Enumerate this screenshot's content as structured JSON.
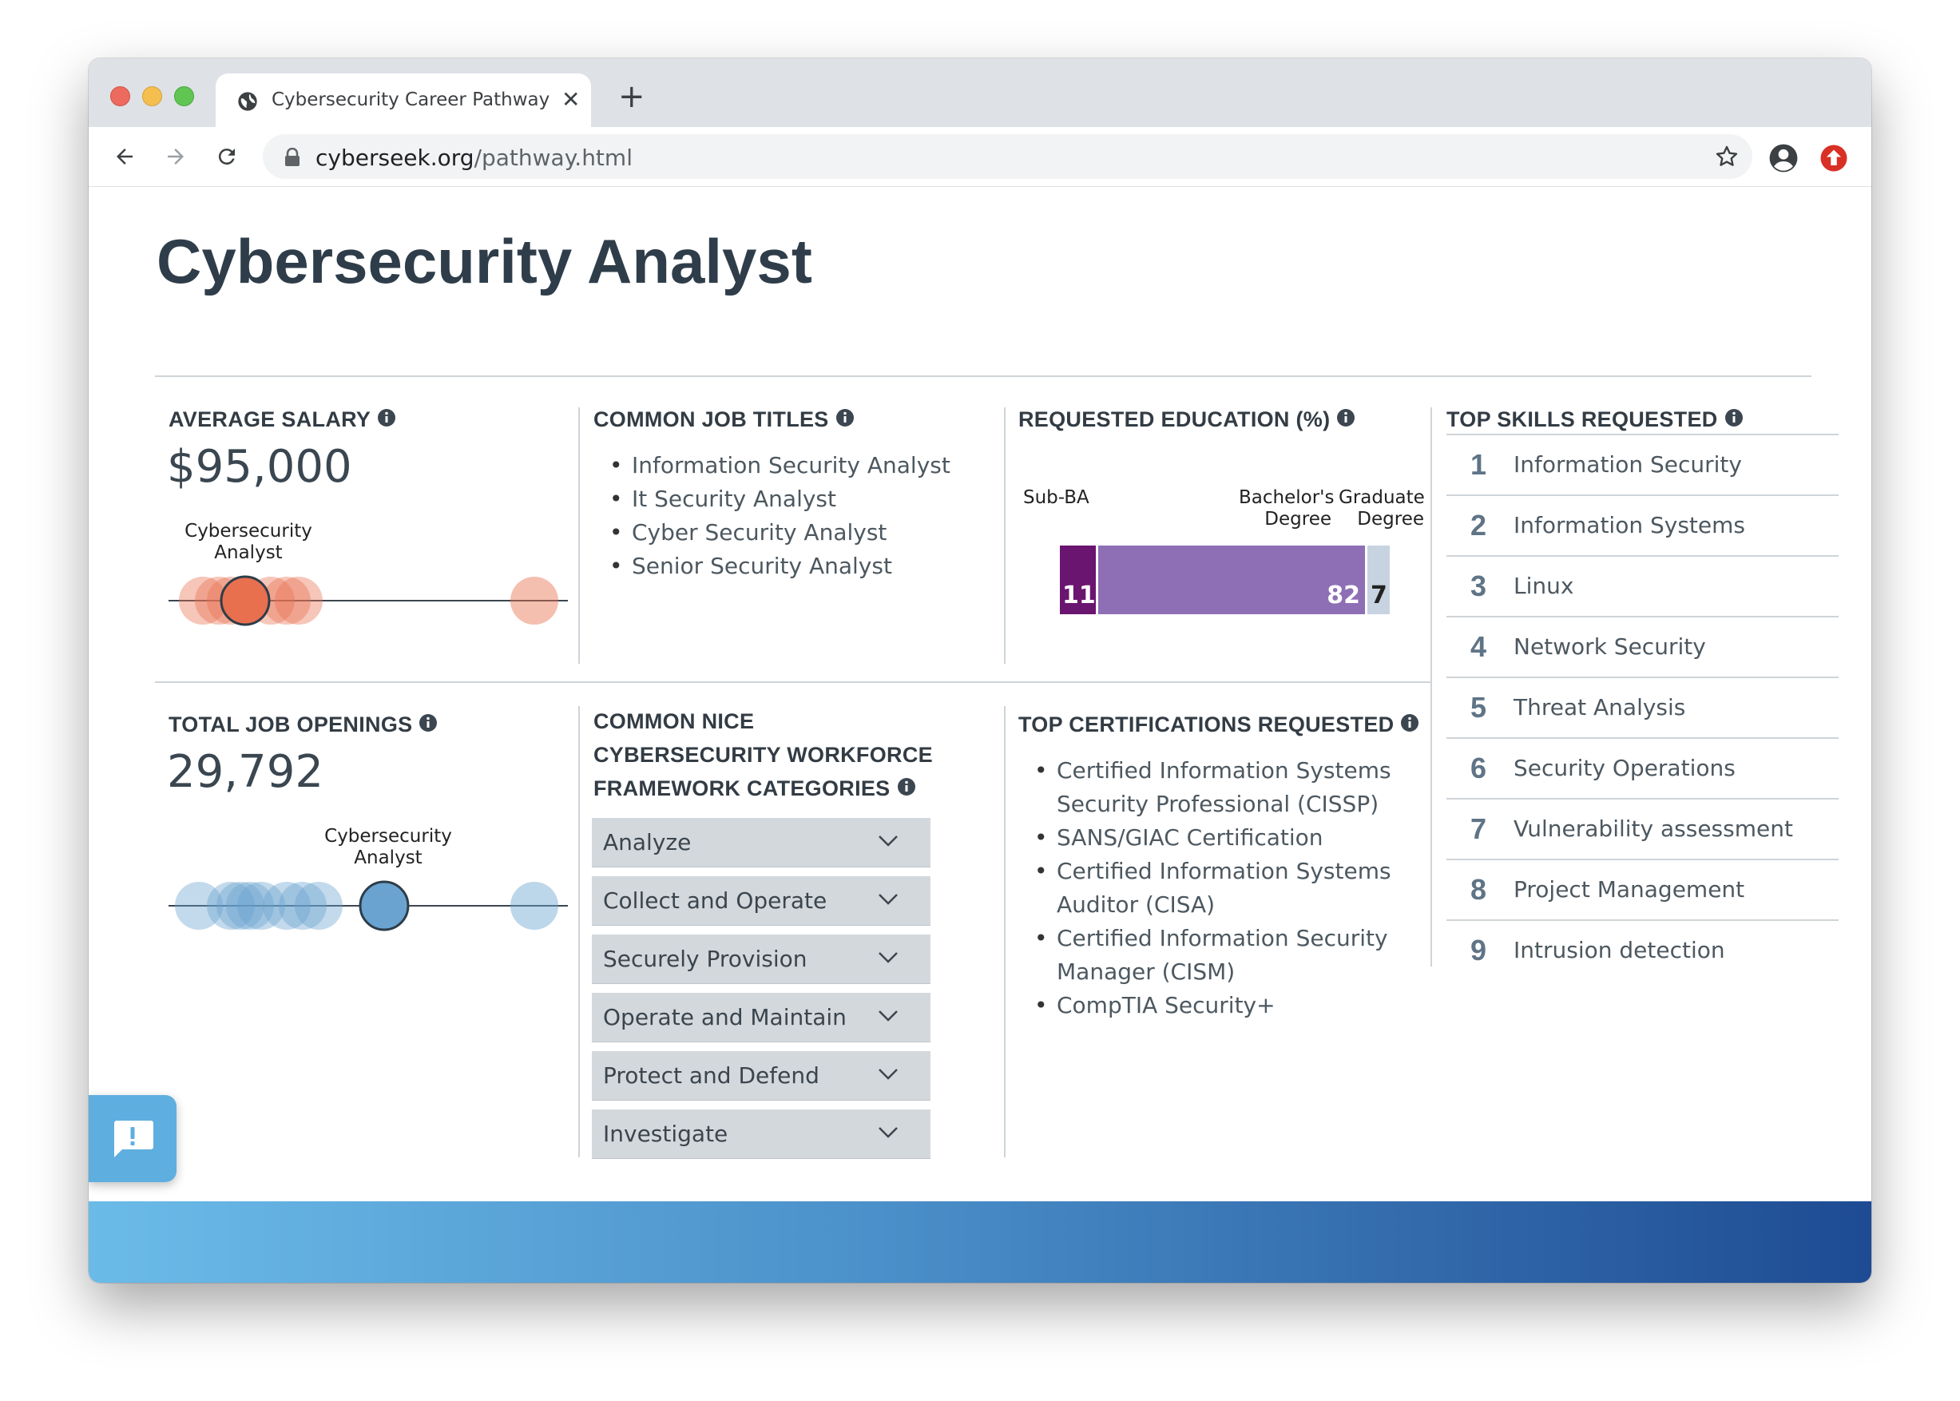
{
  "browser": {
    "tab_title": "Cybersecurity Career Pathway",
    "tab_close": "✕",
    "new_tab": "+",
    "url_domain": "cyberseek.org",
    "url_path": "/pathway.html"
  },
  "page": {
    "title": "Cybersecurity Analyst"
  },
  "salary": {
    "heading": "AVERAGE SALARY",
    "value": "$95,000",
    "bubble_label_line1": "Cybersecurity",
    "bubble_label_line2": "Analyst",
    "color": "#e8704f"
  },
  "job_titles": {
    "heading": "COMMON JOB TITLES",
    "items": [
      "Information Security Analyst",
      "It Security Analyst",
      "Cyber Security Analyst",
      "Senior Security Analyst"
    ]
  },
  "education": {
    "heading": "REQUESTED EDUCATION (%)",
    "labels": {
      "sub_ba": "Sub-BA",
      "bachelors_line1": "Bachelor's",
      "bachelors_line2": "Degree",
      "graduate_line1": "Graduate",
      "graduate_line2": "Degree"
    },
    "values": {
      "sub_ba": "11",
      "bachelors": "82",
      "graduate": "7"
    },
    "colors": {
      "sub_ba": "#6a1570",
      "bachelors": "#8e6fb5",
      "graduate": "#c8d3e2"
    }
  },
  "skills": {
    "heading": "TOP SKILLS REQUESTED",
    "items": [
      {
        "num": "1",
        "label": "Information Security"
      },
      {
        "num": "2",
        "label": "Information Systems"
      },
      {
        "num": "3",
        "label": "Linux"
      },
      {
        "num": "4",
        "label": "Network Security"
      },
      {
        "num": "5",
        "label": "Threat Analysis"
      },
      {
        "num": "6",
        "label": "Security Operations"
      },
      {
        "num": "7",
        "label": "Vulnerability assessment"
      },
      {
        "num": "8",
        "label": "Project Management"
      },
      {
        "num": "9",
        "label": "Intrusion detection"
      }
    ]
  },
  "openings": {
    "heading": "TOTAL JOB OPENINGS",
    "value": "29,792",
    "bubble_label_line1": "Cybersecurity",
    "bubble_label_line2": "Analyst",
    "color": "#6aa3d0"
  },
  "nice": {
    "heading": "COMMON NICE CYBERSECURITY WORKFORCE FRAMEWORK CATEGORIES",
    "items": [
      "Analyze",
      "Collect and Operate",
      "Securely Provision",
      "Operate and Maintain",
      "Protect and Defend",
      "Investigate"
    ]
  },
  "certs": {
    "heading": "TOP CERTIFICATIONS REQUESTED",
    "items": [
      {
        "line1": "Certified Information Systems",
        "line2": "Security Professional (CISSP)"
      },
      {
        "line1": "SANS/GIAC Certification",
        "line2": ""
      },
      {
        "line1": "Certified Information Systems",
        "line2": "Auditor (CISA)"
      },
      {
        "line1": "Certified Information Security",
        "line2": "Manager (CISM)"
      },
      {
        "line1": "CompTIA Security+",
        "line2": ""
      }
    ]
  }
}
